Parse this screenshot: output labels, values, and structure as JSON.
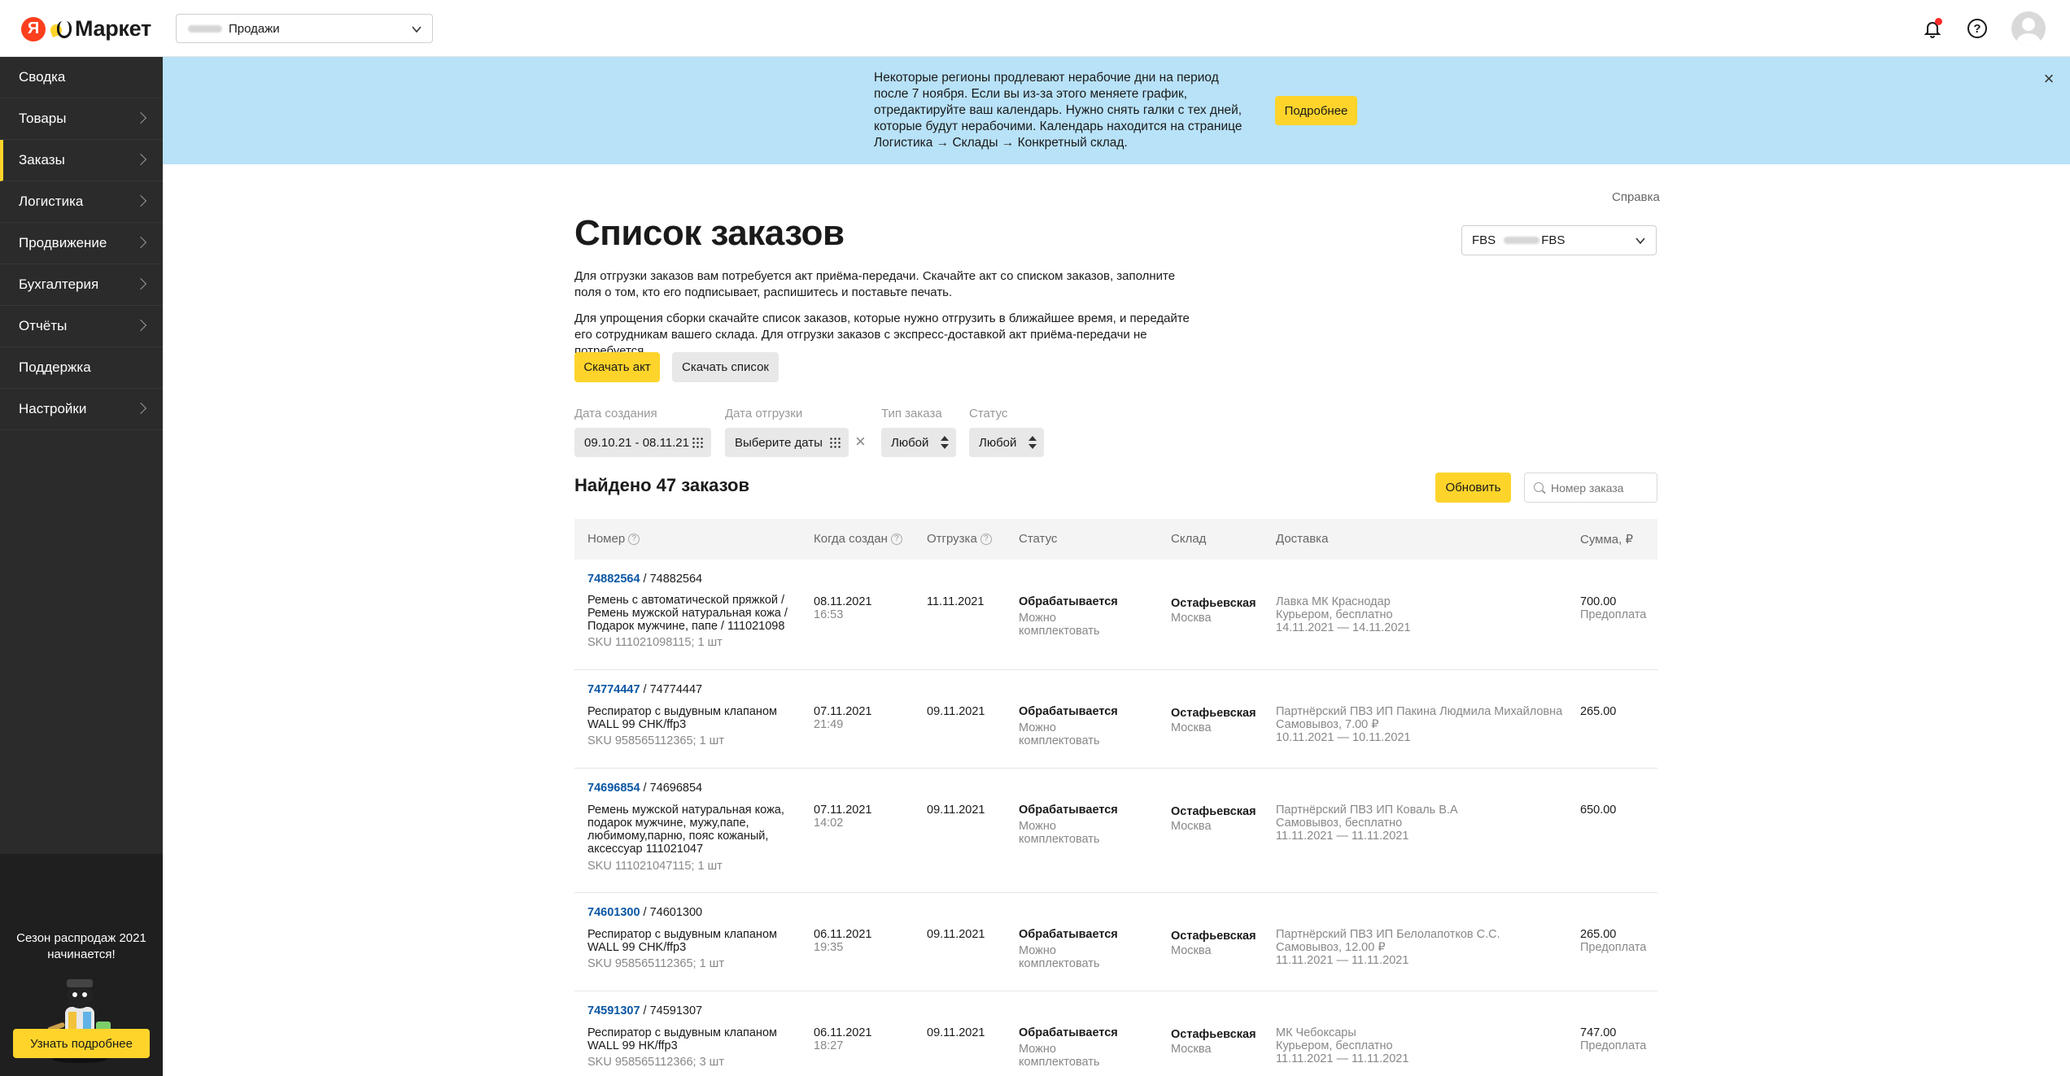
{
  "header": {
    "logo_ya": "Я",
    "logo_text": "Маркет",
    "account_label": "Продажи"
  },
  "sidebar": {
    "items": [
      {
        "label": "Сводка",
        "chevron": false,
        "active": false
      },
      {
        "label": "Товары",
        "chevron": true,
        "active": false
      },
      {
        "label": "Заказы",
        "chevron": true,
        "active": true
      },
      {
        "label": "Логистика",
        "chevron": true,
        "active": false
      },
      {
        "label": "Продвижение",
        "chevron": true,
        "active": false
      },
      {
        "label": "Бухгалтерия",
        "chevron": true,
        "active": false
      },
      {
        "label": "Отчёты",
        "chevron": true,
        "active": false
      },
      {
        "label": "Поддержка",
        "chevron": false,
        "active": false
      },
      {
        "label": "Настройки",
        "chevron": true,
        "active": false
      }
    ],
    "promo_text": "Сезон распродаж 2021 начинается!",
    "promo_button": "Узнать подробнее"
  },
  "banner": {
    "text": "Некоторые регионы продлевают нерабочие дни на период после 7 ноября. Если вы из-за этого меняете график, отредактируйте ваш календарь. Нужно снять галки с тех дней, которые будут нерабочими. Календарь находится на странице Логистика → Склады → Конкретный склад.",
    "button": "Подробнее",
    "close": "×"
  },
  "main": {
    "help_link": "Справка",
    "title": "Список заказов",
    "store_prefix": "FBS",
    "store_suffix": "FBS",
    "para1": "Для отгрузки заказов вам потребуется акт приёма-передачи. Скачайте акт со списком заказов, заполните поля о том, кто его подписывает, распишитесь и поставьте печать.",
    "para2": "Для упрощения сборки скачайте список заказов, которые нужно отгрузить в ближайшее время, и передайте его сотрудникам вашего склада. Для отгрузки заказов с экспресс-доставкой акт приёма-передачи не потребуется.",
    "btn_act": "Скачать акт",
    "btn_list": "Скачать список"
  },
  "filters": {
    "created_label": "Дата создания",
    "created_value": "09.10.21 - 08.11.21",
    "ship_label": "Дата отгрузки",
    "ship_value": "Выберите даты",
    "type_label": "Тип заказа",
    "type_value": "Любой",
    "status_label": "Статус",
    "status_value": "Любой",
    "clear": "×"
  },
  "results": {
    "found": "Найдено 47 заказов",
    "refresh": "Обновить",
    "search_placeholder": "Номер заказа"
  },
  "table": {
    "columns": {
      "number": "Номер",
      "created": "Когда создан",
      "shipment": "Отгрузка",
      "status": "Статус",
      "warehouse": "Склад",
      "delivery": "Доставка",
      "sum": "Сумма, ₽"
    },
    "rows": [
      {
        "id": "74882564",
        "id2": " / 74882564",
        "desc": "Ремень с автоматической пряжкой / Ремень мужской натуральная кожа / Подарок мужчине, папе / 111021098",
        "sku": "SKU 111021098115; 1 шт",
        "date": "08.11.2021",
        "time": "16:53",
        "ship": "11.11.2021",
        "status": "Обрабатывается",
        "substatus": "Можно комплектовать",
        "wh": "Остафьевская",
        "city": "Москва",
        "d1": "Лавка МК Краснодар",
        "d2": "Курьером, бесплатно",
        "d3": "14.11.2021 — 14.11.2021",
        "sum": "700.00",
        "pay": "Предоплата"
      },
      {
        "id": "74774447",
        "id2": " / 74774447",
        "desc": "Респиратор с выдувным клапаном WALL 99 CHK/ffp3",
        "sku": "SKU 958565112365; 1 шт",
        "date": "07.11.2021",
        "time": "21:49",
        "ship": "09.11.2021",
        "status": "Обрабатывается",
        "substatus": "Можно комплектовать",
        "wh": "Остафьевская",
        "city": "Москва",
        "d1": "Партнёрский ПВЗ ИП Пакина Людмила Михайловна",
        "d2": "Самовывоз, 7.00 ₽",
        "d3": "10.11.2021 — 10.11.2021",
        "sum": "265.00",
        "pay": ""
      },
      {
        "id": "74696854",
        "id2": " / 74696854",
        "desc": "Ремень мужской натуральная кожа, подарок мужчине, мужу,папе, любимому,парню, пояс кожаный, аксессуар 111021047",
        "sku": "SKU 111021047115; 1 шт",
        "date": "07.11.2021",
        "time": "14:02",
        "ship": "09.11.2021",
        "status": "Обрабатывается",
        "substatus": "Можно комплектовать",
        "wh": "Остафьевская",
        "city": "Москва",
        "d1": "Партнёрский ПВЗ ИП Коваль В.А",
        "d2": "Самовывоз, бесплатно",
        "d3": "11.11.2021 — 11.11.2021",
        "sum": "650.00",
        "pay": ""
      },
      {
        "id": "74601300",
        "id2": " / 74601300",
        "desc": "Респиратор с выдувным клапаном WALL 99 CHK/ffp3",
        "sku": "SKU 958565112365; 1 шт",
        "date": "06.11.2021",
        "time": "19:35",
        "ship": "09.11.2021",
        "status": "Обрабатывается",
        "substatus": "Можно комплектовать",
        "wh": "Остафьевская",
        "city": "Москва",
        "d1": "Партнёрский ПВЗ ИП Белолапотков С.С.",
        "d2": "Самовывоз, 12.00 ₽",
        "d3": "11.11.2021 — 11.11.2021",
        "sum": "265.00",
        "pay": "Предоплата"
      },
      {
        "id": "74591307",
        "id2": " / 74591307",
        "desc": "Респиратор с выдувным клапаном WALL 99 HK/ffp3",
        "sku": "SKU 958565112366; 3 шт",
        "date": "06.11.2021",
        "time": "18:27",
        "ship": "09.11.2021",
        "status": "Обрабатывается",
        "substatus": "Можно комплектовать",
        "wh": "Остафьевская",
        "city": "Москва",
        "d1": "МК Чебоксары",
        "d2": "Курьером, бесплатно",
        "d3": "11.11.2021 — 11.11.2021",
        "sum": "747.00",
        "pay": "Предоплата"
      }
    ]
  }
}
